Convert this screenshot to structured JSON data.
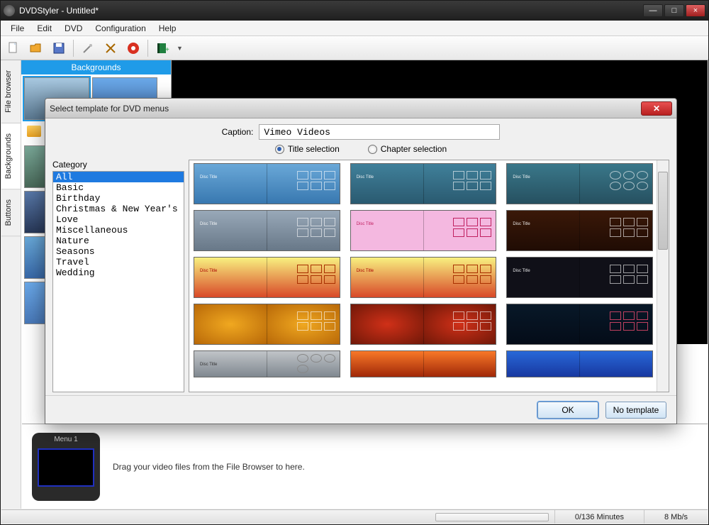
{
  "window": {
    "title": "DVDStyler - Untitled*",
    "min_label": "—",
    "max_label": "□",
    "close_label": "×"
  },
  "menubar": {
    "items": [
      "File",
      "Edit",
      "DVD",
      "Configuration",
      "Help"
    ]
  },
  "toolbar": {
    "icons": [
      "new",
      "open",
      "save",
      "settings",
      "tools",
      "burn",
      "add-video"
    ]
  },
  "sidebar": {
    "tabs": [
      "File browser",
      "Backgrounds",
      "Buttons"
    ],
    "active_index": 1,
    "header": "Backgrounds"
  },
  "timeline": {
    "menu_label": "Menu 1",
    "hint": "Drag your video files from the File Browser to here."
  },
  "statusbar": {
    "minutes": "0/136 Minutes",
    "bitrate": "8 Mb/s"
  },
  "dialog": {
    "title": "Select template for DVD menus",
    "caption_label": "Caption:",
    "caption_value": "Vimeo Videos",
    "mode_title": "Title selection",
    "mode_chapter": "Chapter selection",
    "mode_selected": "title",
    "category_label": "Category",
    "categories": [
      "All",
      "Basic",
      "Birthday",
      "Christmas & New Year's Eve",
      "Love",
      "Miscellaneous",
      "Nature",
      "Seasons",
      "Travel",
      "Wedding"
    ],
    "selected_category_index": 0,
    "ok_label": "OK",
    "no_template_label": "No template",
    "close_label": "✕"
  }
}
